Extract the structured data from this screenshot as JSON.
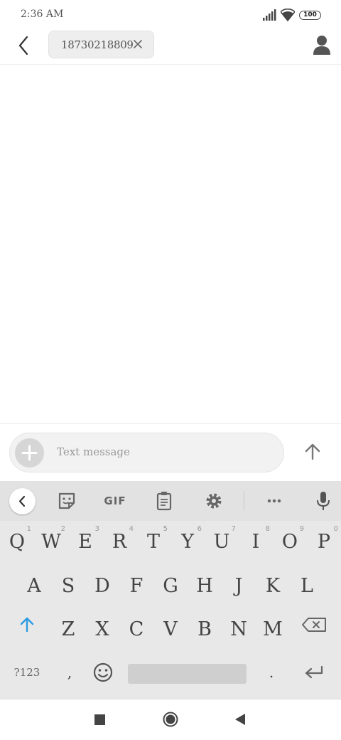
{
  "status_bar": {
    "time": "2:36 AM",
    "battery": "100"
  },
  "header": {
    "recipient": "18730218809"
  },
  "composer": {
    "placeholder": "Text message"
  },
  "keyboard": {
    "toolbar": {
      "gif_label": "GIF"
    },
    "row1": [
      {
        "letter": "Q",
        "hint": "1"
      },
      {
        "letter": "W",
        "hint": "2"
      },
      {
        "letter": "E",
        "hint": "3"
      },
      {
        "letter": "R",
        "hint": "4"
      },
      {
        "letter": "T",
        "hint": "5"
      },
      {
        "letter": "Y",
        "hint": "6"
      },
      {
        "letter": "U",
        "hint": "7"
      },
      {
        "letter": "I",
        "hint": "8"
      },
      {
        "letter": "O",
        "hint": "9"
      },
      {
        "letter": "P",
        "hint": "0"
      }
    ],
    "row2": [
      "A",
      "S",
      "D",
      "F",
      "G",
      "H",
      "J",
      "K",
      "L"
    ],
    "row3": [
      "Z",
      "X",
      "C",
      "V",
      "B",
      "N",
      "M"
    ],
    "symbols_label": "?123",
    "comma": ",",
    "period": ".",
    "accent_color": "#2b9be0"
  }
}
